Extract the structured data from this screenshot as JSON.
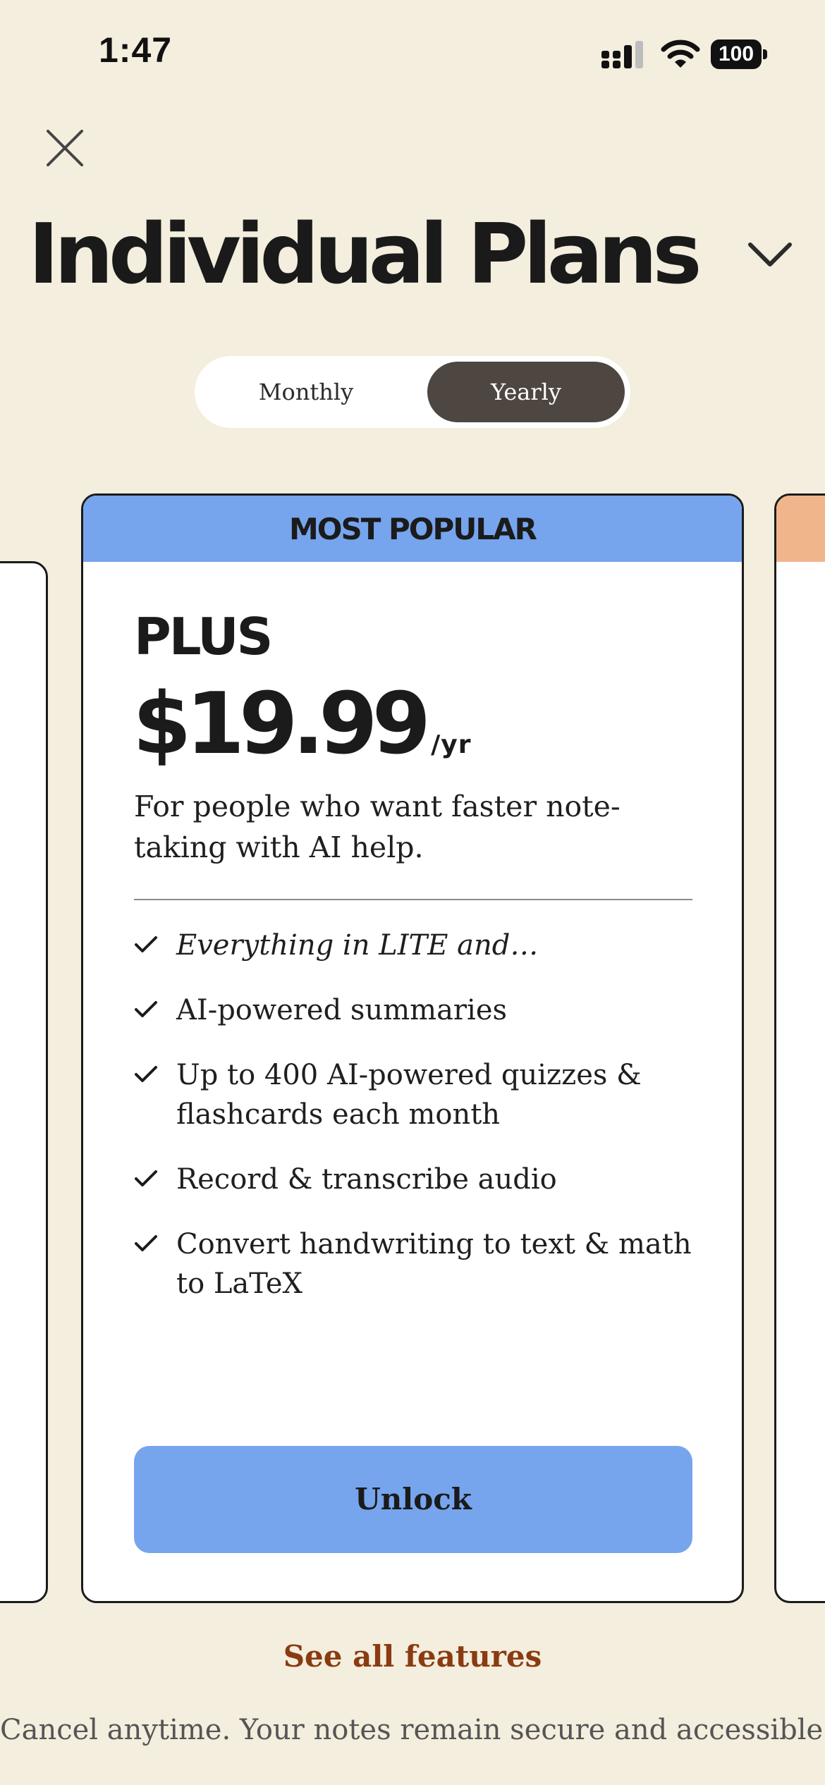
{
  "status_bar": {
    "time": "1:47",
    "battery": "100",
    "icons": [
      "signal-icon",
      "wifi-icon",
      "battery-icon"
    ]
  },
  "header": {
    "close_icon": "close-icon",
    "title": "Individual Plans",
    "chevron_icon": "chevron-down-icon"
  },
  "billing_toggle": {
    "options": [
      "Monthly",
      "Yearly"
    ],
    "selected": "Yearly"
  },
  "plan": {
    "badge": "MOST POPULAR",
    "name": "PLUS",
    "price": "$19.99",
    "period": "/yr",
    "description": "For people who want faster note-taking with AI help.",
    "features": [
      "Everything in LITE and…",
      "AI-powered summaries",
      "Up to 400 AI-powered quizzes & flashcards each month",
      "Record & transcribe audio",
      "Convert handwriting to text & math to LaTeX"
    ],
    "cta": "Unlock"
  },
  "footer": {
    "see_all": "See all features",
    "note": "Cancel anytime. Your notes remain secure and accessible."
  },
  "colors": {
    "background": "#F3EEDD",
    "accent_blue": "#76A5EE",
    "toggle_selected": "#4E4641",
    "link_brown": "#8A3B12",
    "next_card_band": "#F1B58C"
  }
}
